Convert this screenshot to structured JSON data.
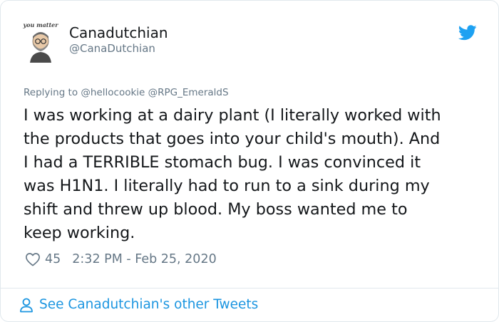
{
  "tweet": {
    "avatar_caption": "you matter",
    "display_name": "Canadutchian",
    "handle": "@CanaDutchian",
    "reply_context": "Replying to @hellocookie @RPG_EmeraldS",
    "text": "I was working at a dairy plant (I literally worked with\nthe products that goes into your child's mouth). And\nI had a TERRIBLE stomach bug. I was convinced it\nwas H1N1. I literally had to run to a sink during my\nshift and threw up blood. My boss wanted me to\nkeep working.",
    "like_count": "45",
    "timestamp": "2:32 PM - Feb 25, 2020",
    "footer_link": "See Canadutchian's other Tweets"
  },
  "colors": {
    "text": "#14171a",
    "muted": "#657786",
    "accent": "#1b95e0",
    "border": "#e1e8ed"
  },
  "icons": {
    "platform": "twitter-bird-icon",
    "like": "heart-icon",
    "footer": "person-icon"
  }
}
